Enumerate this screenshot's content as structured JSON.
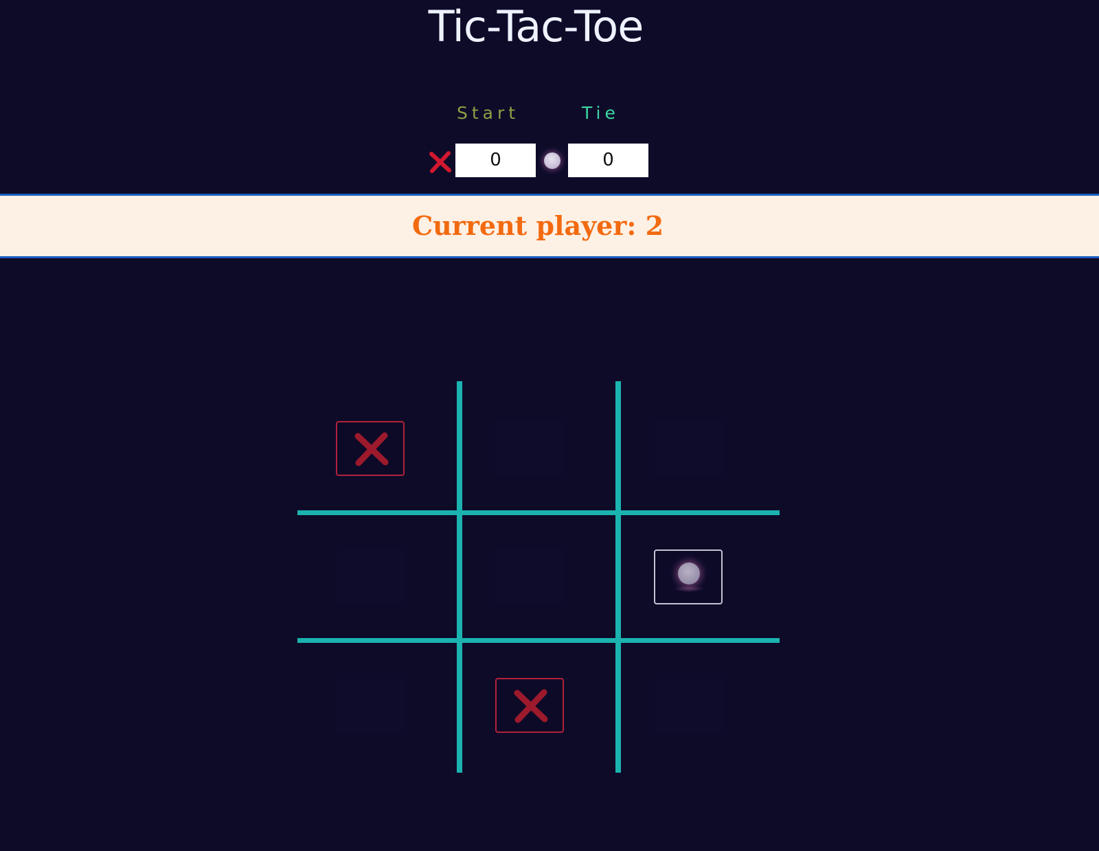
{
  "title": "Tic-Tac-Toe",
  "controls": {
    "start_label": "Start",
    "tie_label": "Tie"
  },
  "scores": {
    "player_x_icon": "x-mark-icon",
    "player_x_score": "0",
    "player_o_icon": "o-orb-icon",
    "player_o_score": "0"
  },
  "status": {
    "text": "Current player: 2"
  },
  "board": {
    "cells": [
      "X",
      "",
      "",
      "",
      "",
      "O",
      "",
      "X",
      ""
    ]
  },
  "colors": {
    "background": "#0e0b29",
    "grid": "#1bb3b0",
    "x_mark": "#b3223a",
    "banner_bg": "#fdf0e4",
    "banner_text": "#f26a10",
    "banner_border": "#1b5fc4",
    "start": "#8da043",
    "tie": "#3fd7a3"
  }
}
